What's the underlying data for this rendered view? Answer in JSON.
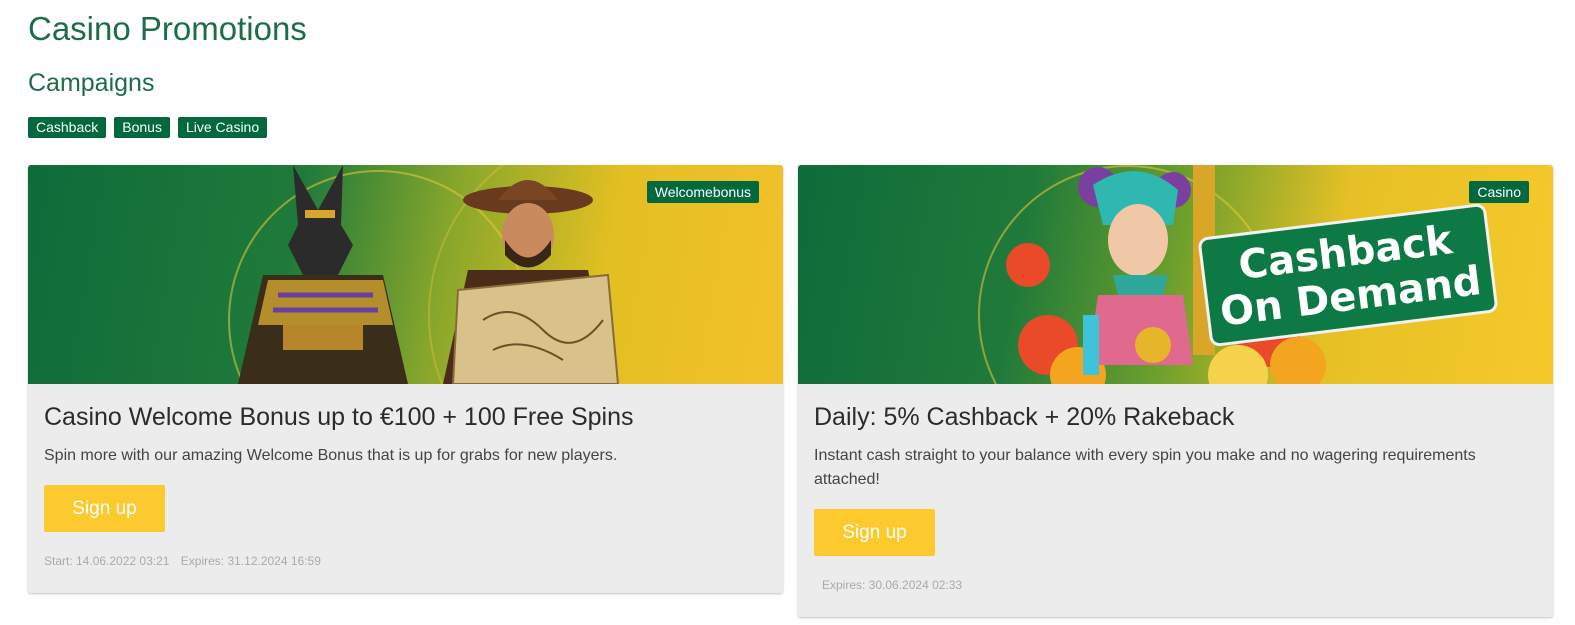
{
  "page": {
    "title": "Casino Promotions",
    "section_title": "Campaigns"
  },
  "filters": [
    "Cashback",
    "Bonus",
    "Live Casino"
  ],
  "cards": [
    {
      "badge": "Welcomebonus",
      "title": "Casino Welcome Bonus up to €100 + 100 Free Spins",
      "description": "Spin more with our amazing Welcome Bonus that is up for grabs for new players.",
      "button": "Sign up",
      "start": "Start: 14.06.2022 03:21",
      "expires": "Expires: 31.12.2024 16:59"
    },
    {
      "badge": "Casino",
      "title": "Daily: 5% Cashback + 20% Rakeback",
      "description": "Instant cash straight to your balance with every spin you make and no wagering requirements attached!",
      "button": "Sign up",
      "expires": "Expires: 30.06.2024 02:33",
      "banner_text_line1": "Cashback",
      "banner_text_line2": "On Demand"
    }
  ],
  "colors": {
    "brand_green": "#02683e",
    "heading_green": "#1b6e47",
    "cta_yellow": "#fcc92e"
  }
}
